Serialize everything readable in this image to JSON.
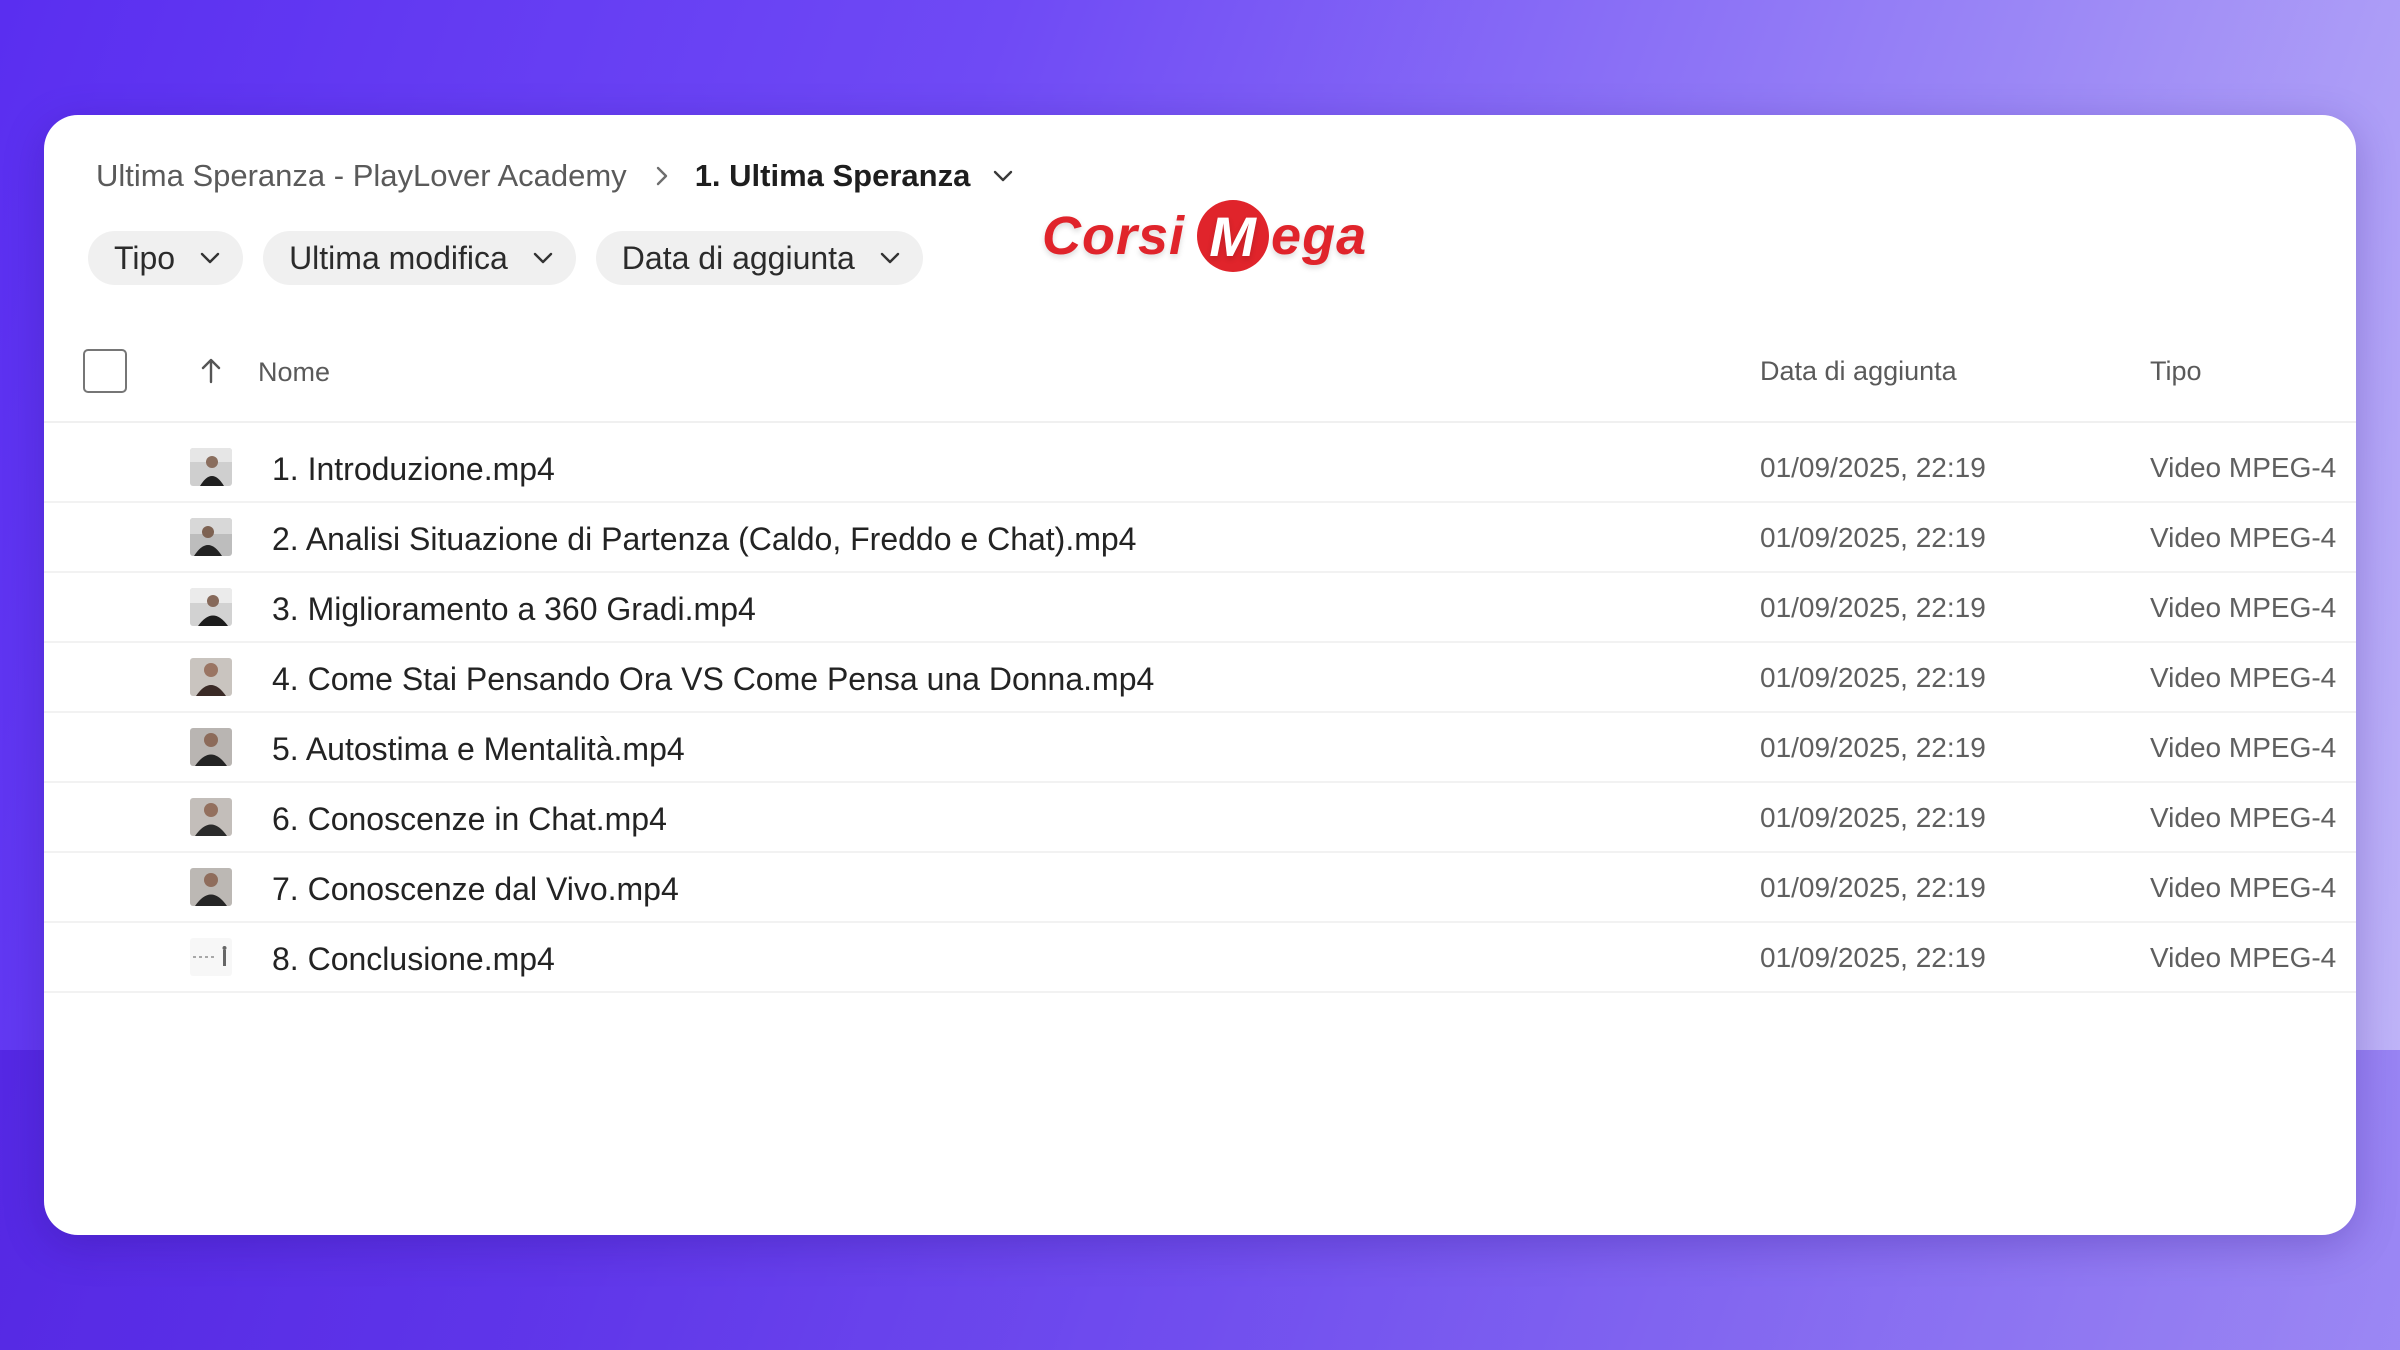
{
  "breadcrumb": {
    "parent": "Ultima Speranza - PlayLover Academy",
    "current": "1. Ultima Speranza"
  },
  "filters": [
    {
      "label": "Tipo"
    },
    {
      "label": "Ultima modifica"
    },
    {
      "label": "Data di aggiunta"
    }
  ],
  "logo": {
    "prefix": "Corsi",
    "m": "M",
    "suffix": "ega",
    "color": "#e0242b"
  },
  "table": {
    "columns": {
      "name": "Nome",
      "date_added": "Data di aggiunta",
      "type": "Tipo"
    },
    "rows": [
      {
        "name": "1. Introduzione.mp4",
        "date": "01/09/2025, 22:19",
        "type": "Video MPEG-4"
      },
      {
        "name": "2. Analisi Situazione di Partenza (Caldo, Freddo e Chat).mp4",
        "date": "01/09/2025, 22:19",
        "type": "Video MPEG-4"
      },
      {
        "name": "3. Miglioramento a 360 Gradi.mp4",
        "date": "01/09/2025, 22:19",
        "type": "Video MPEG-4"
      },
      {
        "name": "4. Come Stai Pensando Ora VS Come Pensa una Donna.mp4",
        "date": "01/09/2025, 22:19",
        "type": "Video MPEG-4"
      },
      {
        "name": "5. Autostima e Mentalità.mp4",
        "date": "01/09/2025, 22:19",
        "type": "Video MPEG-4"
      },
      {
        "name": "6. Conoscenze in Chat.mp4",
        "date": "01/09/2025, 22:19",
        "type": "Video MPEG-4"
      },
      {
        "name": "7. Conoscenze dal Vivo.mp4",
        "date": "01/09/2025, 22:19",
        "type": "Video MPEG-4"
      },
      {
        "name": "8. Conclusione.mp4",
        "date": "01/09/2025, 22:19",
        "type": "Video MPEG-4"
      }
    ]
  }
}
